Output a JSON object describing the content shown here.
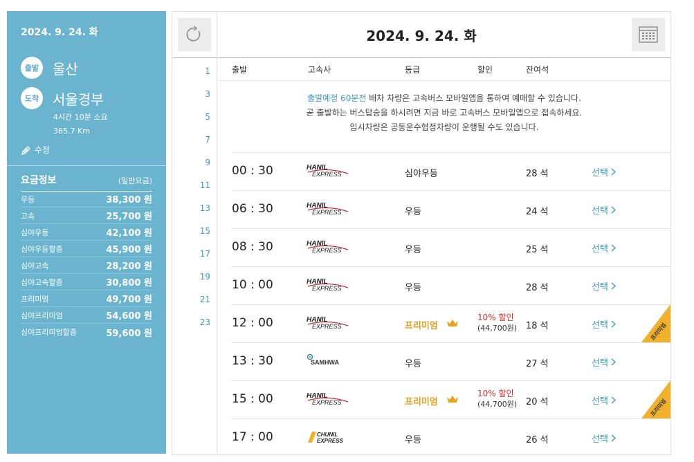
{
  "sidebar": {
    "date": "2024. 9. 24. 화",
    "departure_badge": "출발",
    "departure": "울산",
    "arrival_badge": "도착",
    "arrival": "서울경부",
    "duration": "4시간 10분 소요",
    "distance": "365.7 Km",
    "edit_label": "수정",
    "fare_title": "요금정보",
    "fare_note": "(일반요금)",
    "fares": [
      {
        "name": "우등",
        "amount": "38,300 원"
      },
      {
        "name": "고속",
        "amount": "25,700 원"
      },
      {
        "name": "심야우등",
        "amount": "42,100 원"
      },
      {
        "name": "심야우등할증",
        "amount": "45,900 원"
      },
      {
        "name": "심야고속",
        "amount": "28,200 원"
      },
      {
        "name": "심야고속할증",
        "amount": "30,800 원"
      },
      {
        "name": "프리미엄",
        "amount": "49,700 원"
      },
      {
        "name": "심야프리미엄",
        "amount": "54,600 원"
      },
      {
        "name": "심야프리미엄할증",
        "amount": "59,600 원"
      }
    ]
  },
  "header": {
    "title": "2024. 9. 24. 화"
  },
  "hours": [
    "1",
    "3",
    "5",
    "7",
    "9",
    "11",
    "13",
    "15",
    "17",
    "19",
    "21",
    "23"
  ],
  "columns": {
    "depart": "출발",
    "company": "고속사",
    "grade": "등급",
    "discount": "할인",
    "seats": "잔여석"
  },
  "notice": {
    "highlight": "출발예정 60분전",
    "line1_rest": " 배차 차량은 고속버스 모바일앱을 통하여 예매할 수 있습니다.",
    "line2": "곧 출발하는 버스탑승을 하시려면 지금 바로 고속버스 모바일앱으로 접속하세요.",
    "line3": "임시차량은 공동운수협정차량이 운행될 수도 있습니다."
  },
  "schedules": [
    {
      "time": "00 : 30",
      "company": "HANIL EXPRESS",
      "grade": "심야우등",
      "premium": false,
      "discount": "",
      "discount_price": "",
      "seats": "28 석",
      "select": "선택"
    },
    {
      "time": "06 : 30",
      "company": "HANIL EXPRESS",
      "grade": "우등",
      "premium": false,
      "discount": "",
      "discount_price": "",
      "seats": "24 석",
      "select": "선택"
    },
    {
      "time": "08 : 30",
      "company": "HANIL EXPRESS",
      "grade": "우등",
      "premium": false,
      "discount": "",
      "discount_price": "",
      "seats": "25 석",
      "select": "선택"
    },
    {
      "time": "10 : 00",
      "company": "HANIL EXPRESS",
      "grade": "우등",
      "premium": false,
      "discount": "",
      "discount_price": "",
      "seats": "28 석",
      "select": "선택"
    },
    {
      "time": "12 : 00",
      "company": "HANIL EXPRESS",
      "grade": "프리미엄",
      "premium": true,
      "discount": "10% 할인",
      "discount_price": "(44,700원)",
      "seats": "18 석",
      "select": "선택",
      "ribbon": "프리미엄"
    },
    {
      "time": "13 : 30",
      "company": "SAMHWA",
      "grade": "우등",
      "premium": false,
      "discount": "",
      "discount_price": "",
      "seats": "27 석",
      "select": "선택"
    },
    {
      "time": "15 : 00",
      "company": "HANIL EXPRESS",
      "grade": "프리미엄",
      "premium": true,
      "discount": "10% 할인",
      "discount_price": "(44,700원)",
      "seats": "20 석",
      "select": "선택",
      "ribbon": "프리미엄"
    },
    {
      "time": "17 : 00",
      "company": "CHUNIL EXPRESS",
      "grade": "우등",
      "premium": false,
      "discount": "",
      "discount_price": "",
      "seats": "26 석",
      "select": "선택"
    }
  ],
  "colors": {
    "sidebar_bg": "#6ab4cf",
    "accent": "#3a9ac0",
    "premium": "#e79c1c",
    "discount": "#d82c2c",
    "ribbon": "#f2b12a"
  }
}
